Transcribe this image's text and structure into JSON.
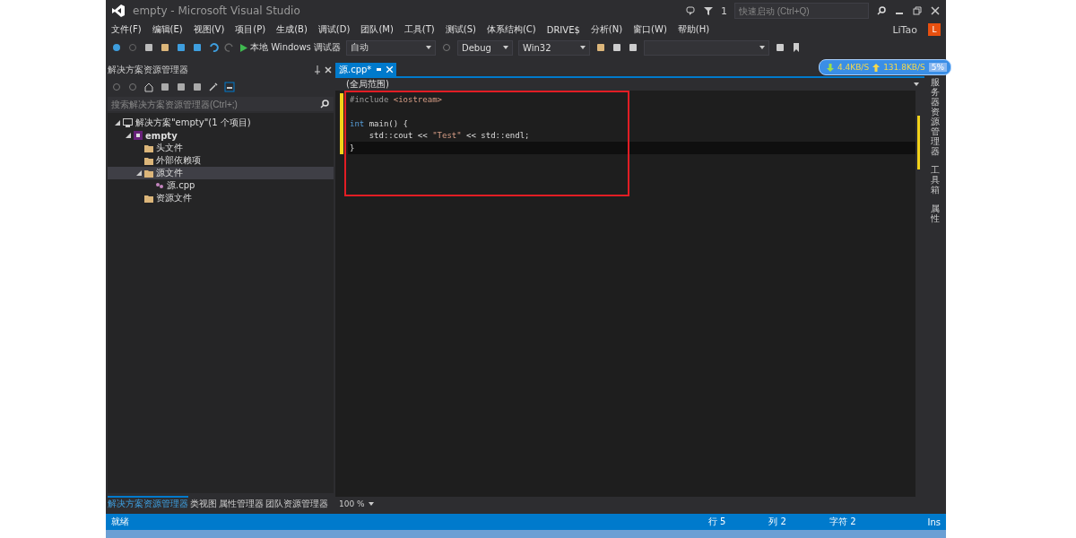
{
  "window": {
    "title": "empty - Microsoft Visual Studio"
  },
  "title_bar": {
    "notification_count": "1",
    "quick_launch": {
      "placeholder": "快速启动 (Ctrl+Q)"
    }
  },
  "menu": [
    "文件(F)",
    "编辑(E)",
    "视图(V)",
    "项目(P)",
    "生成(B)",
    "调试(D)",
    "团队(M)",
    "工具(T)",
    "测试(S)",
    "体系结构(C)",
    "DRIVE$",
    "分析(N)",
    "窗口(W)",
    "帮助(H)"
  ],
  "account": {
    "user": "LiTao",
    "avatar": "L"
  },
  "toolbar": {
    "debugger": "本地 Windows 调试器",
    "mode": "自动",
    "configuration": "Debug",
    "platform": "Win32"
  },
  "solution_explorer": {
    "title": "解决方案资源管理器",
    "search": {
      "placeholder": "搜索解决方案资源管理器(Ctrl+;)"
    },
    "tree": [
      {
        "label": "解决方案\"empty\"(1 个项目)",
        "kind": "solution",
        "bold": false,
        "selected": false,
        "expanded": true,
        "children": [
          {
            "label": "empty",
            "kind": "project",
            "bold": true,
            "selected": false,
            "expanded": true,
            "children": [
              {
                "label": "头文件",
                "kind": "folder",
                "bold": false,
                "selected": false,
                "expanded": false
              },
              {
                "label": "外部依赖项",
                "kind": "folder",
                "bold": false,
                "selected": false,
                "expanded": false
              },
              {
                "label": "源文件",
                "kind": "folder",
                "bold": false,
                "selected": true,
                "expanded": true,
                "children": [
                  {
                    "label": "源.cpp",
                    "kind": "file",
                    "bold": false,
                    "selected": false,
                    "expanded": false
                  }
                ]
              },
              {
                "label": "资源文件",
                "kind": "folder",
                "bold": false,
                "selected": false,
                "expanded": false
              }
            ]
          }
        ]
      }
    ]
  },
  "bottom_tabs": [
    {
      "label": "解决方案资源管理器",
      "selected": true
    },
    {
      "label": "类视图",
      "selected": false
    },
    {
      "label": "属性管理器",
      "selected": false
    },
    {
      "label": "团队资源管理器",
      "selected": false
    }
  ],
  "editor": {
    "tab": {
      "label": "源.cpp*",
      "selected": true
    },
    "scope": "(全局范围)",
    "lines": [
      {
        "current": false,
        "tokens": [
          {
            "kind": "preproc",
            "text": "#include "
          },
          {
            "kind": "string",
            "text": "<iostream>"
          }
        ]
      },
      {
        "current": false
      },
      {
        "current": false,
        "tokens": [
          {
            "kind": "keyword",
            "text": "int"
          },
          {
            "kind": "plain",
            "text": " main() {"
          }
        ]
      },
      {
        "current": false,
        "tokens": [
          {
            "kind": "plain",
            "text": "    std::cout << "
          },
          {
            "kind": "string",
            "text": "\"Test\""
          },
          {
            "kind": "plain",
            "text": " << std::endl;"
          }
        ]
      },
      {
        "current": true,
        "tokens": [
          {
            "kind": "plain",
            "text": "}"
          }
        ]
      }
    ],
    "zoom": "100 %"
  },
  "network_monitor": {
    "download": "4.4KB/S",
    "upload": "131.8KB/S",
    "percent": "5%"
  },
  "right_tabs": [
    "服务器资源管理器",
    "工具箱",
    "属性"
  ],
  "status_bar": {
    "message": "就绪",
    "line": "行 5",
    "column": "列 2",
    "char": "字符 2",
    "mode": "Ins"
  }
}
